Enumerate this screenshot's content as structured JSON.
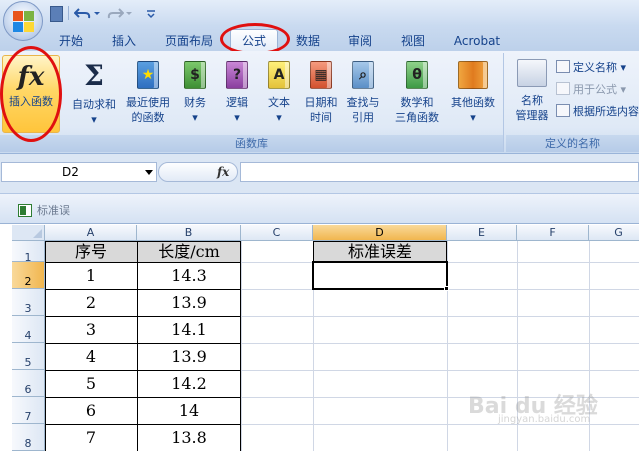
{
  "tabs": [
    "开始",
    "插入",
    "页面布局",
    "公式",
    "数据",
    "审阅",
    "视图",
    "Acrobat"
  ],
  "ribbon": {
    "insert_function": "插入函数",
    "autosum": "自动求和",
    "recent": [
      "最近使用",
      "的函数"
    ],
    "financial": "财务",
    "logical": "逻辑",
    "text": "文本",
    "datetime": [
      "日期和",
      "时间"
    ],
    "lookup": [
      "查找与",
      "引用"
    ],
    "math": [
      "数学和",
      "三角函数"
    ],
    "more": "其他函数",
    "name_manager": [
      "名称",
      "管理器"
    ],
    "define_name": "定义名称",
    "use_in_formula": "用于公式",
    "create_from_selection": "根据所选内容创建",
    "group_library": "函数库",
    "group_names": "定义的名称"
  },
  "formula_bar": {
    "name_box": "D2",
    "formula": ""
  },
  "sheet": {
    "title": "标准误",
    "columns": [
      "A",
      "B",
      "C",
      "D",
      "E",
      "F",
      "G"
    ],
    "rows": [
      "1",
      "2",
      "3",
      "4",
      "5",
      "6",
      "7",
      "8"
    ],
    "table_header": [
      "序号",
      "长度/cm"
    ],
    "table_rows": [
      [
        "1",
        "14.3"
      ],
      [
        "2",
        "13.9"
      ],
      [
        "3",
        "14.1"
      ],
      [
        "4",
        "13.9"
      ],
      [
        "5",
        "14.2"
      ],
      [
        "6",
        "14"
      ],
      [
        "7",
        "13.8"
      ]
    ],
    "d_header": "标准误差"
  },
  "watermark": {
    "main": "Bai du 经验",
    "sub": "jingyan.baidu.com"
  },
  "colors": {
    "accent_red": "#e01010",
    "selected_header": "#f1b64f",
    "table_header_fill": "#d9d9d9"
  }
}
